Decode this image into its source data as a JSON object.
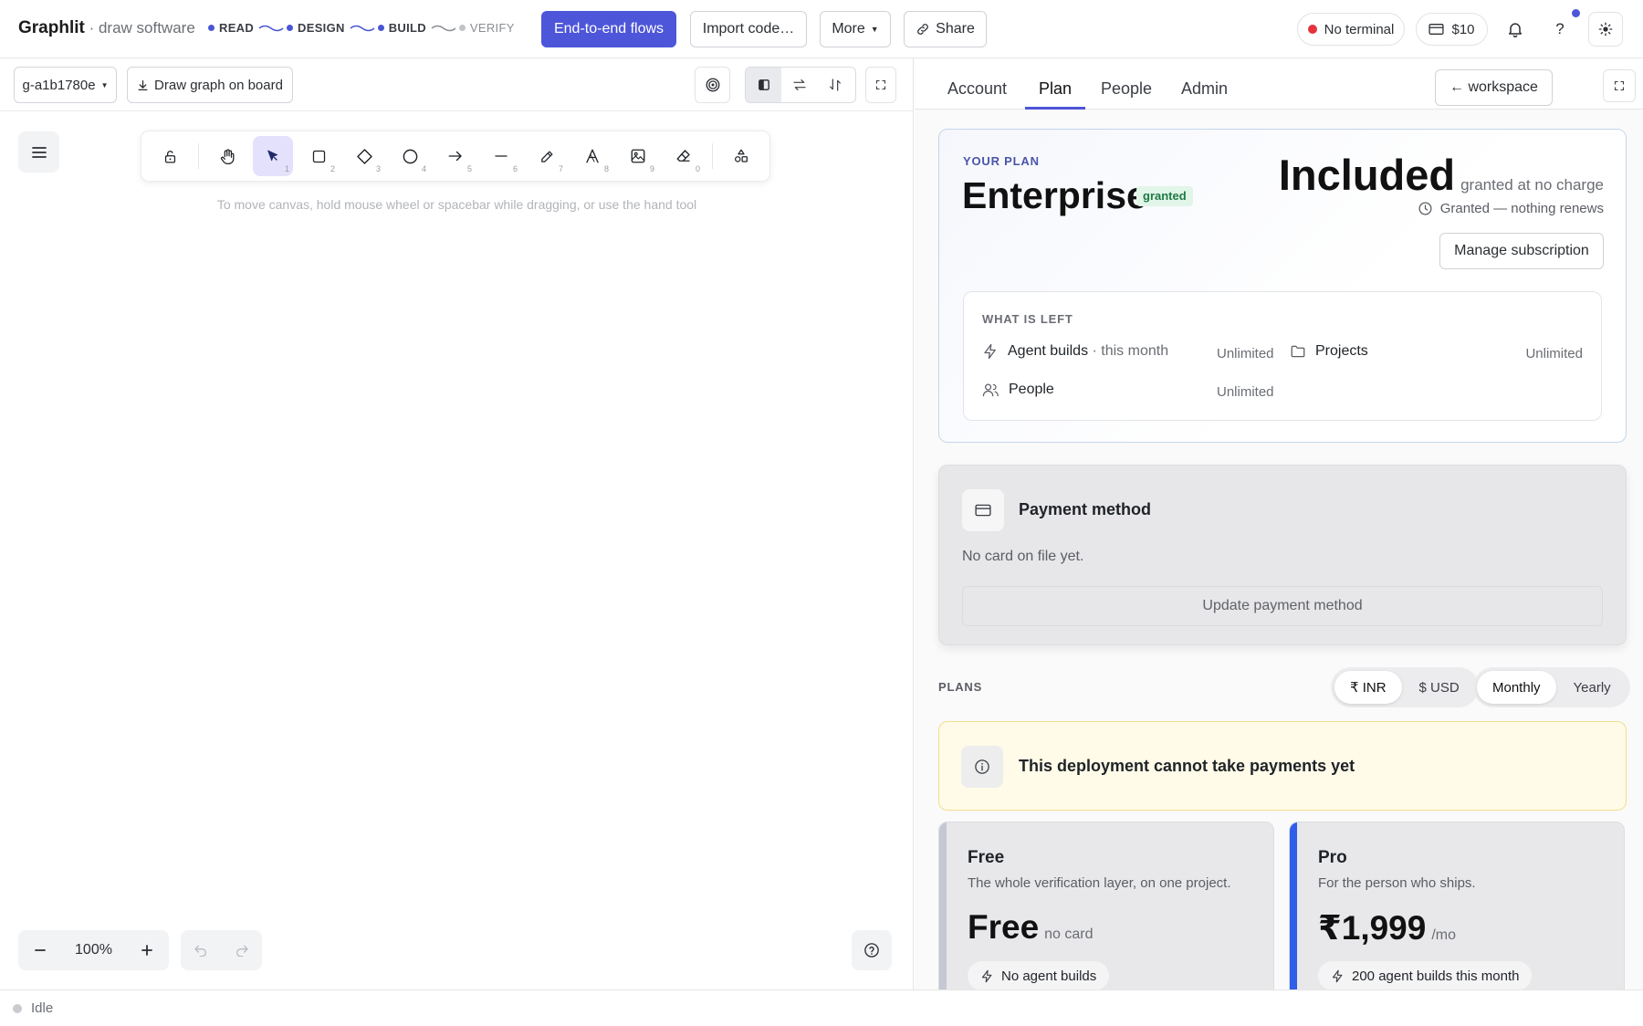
{
  "header": {
    "brand_name": "Graphlit",
    "brand_sep": " · ",
    "brand_sub": "draw software",
    "pipeline": [
      "READ",
      "DESIGN",
      "BUILD",
      "VERIFY"
    ],
    "e2e_label": "End-to-end flows",
    "import_label": "Import code…",
    "more_label": "More",
    "share_label": "Share",
    "terminal_label": "No terminal",
    "credit_label": "$10",
    "help_label": "?"
  },
  "canvas": {
    "graph_select": "g-a1b1780e",
    "draw_graph_label": "Draw graph on board",
    "tool_keys": [
      "1",
      "2",
      "3",
      "4",
      "5",
      "6",
      "7",
      "8",
      "9",
      "0"
    ],
    "hint": "To move canvas, hold mouse wheel or spacebar while dragging, or use the hand tool",
    "zoom_level": "100%"
  },
  "status": {
    "text": "Idle"
  },
  "panel": {
    "tabs": [
      "Account",
      "Plan",
      "People",
      "Admin"
    ],
    "active_tab": "Plan",
    "workspace_label": "← workspace",
    "plan": {
      "eyebrow": "YOUR PLAN",
      "name": "Enterprise",
      "badge": "granted",
      "price": "Included",
      "price_note": "granted at no charge",
      "renew_note": "Granted — nothing renews",
      "manage_label": "Manage subscription"
    },
    "left": {
      "title": "WHAT IS LEFT",
      "rows": [
        {
          "label": "Agent builds",
          "sub": " · this month",
          "value": "Unlimited"
        },
        {
          "label": "Projects",
          "value": "Unlimited"
        },
        {
          "label": "People",
          "value": "Unlimited"
        }
      ]
    },
    "payment": {
      "title": "Payment method",
      "none": "No card on file yet.",
      "update_label": "Update payment method"
    },
    "plans_label": "PLANS",
    "currency": {
      "options": [
        "₹ INR",
        "$ USD"
      ],
      "selected": "₹ INR"
    },
    "billing": {
      "options": [
        "Monthly",
        "Yearly"
      ],
      "selected": "Monthly"
    },
    "warning": "This deployment cannot take payments yet",
    "tiers": [
      {
        "name": "Free",
        "desc": "The whole verification layer, on one project.",
        "price": "Free",
        "price_note": "no card",
        "chip": "No agent builds",
        "accent": "#c5c8d2"
      },
      {
        "name": "Pro",
        "desc": "For the person who ships.",
        "price": "₹1,999",
        "price_note": "/mo",
        "chip": "200 agent builds this month",
        "accent": "#2f5ee8"
      }
    ]
  },
  "colors": {
    "accent": "#4d55d9",
    "terminal_dot": "#e5333b",
    "notification_dot": "#4d55d9"
  },
  "icons": [
    "share-link-icon",
    "card-icon",
    "bell-icon",
    "sun-icon",
    "download-icon",
    "target-icon",
    "panel-left-icon",
    "swap-horizontal-icon",
    "swap-vertical-icon",
    "expand-icon",
    "menu-icon",
    "lock-open-icon",
    "hand-icon",
    "pointer-icon",
    "rectangle-icon",
    "diamond-icon",
    "ellipse-icon",
    "arrow-icon",
    "line-icon",
    "pencil-icon",
    "text-icon",
    "image-icon",
    "eraser-icon",
    "shapes-icon",
    "minus-icon",
    "plus-icon",
    "undo-icon",
    "redo-icon",
    "help-circle-icon",
    "clock-icon",
    "lightning-icon",
    "folder-icon",
    "users-icon",
    "info-icon"
  ]
}
